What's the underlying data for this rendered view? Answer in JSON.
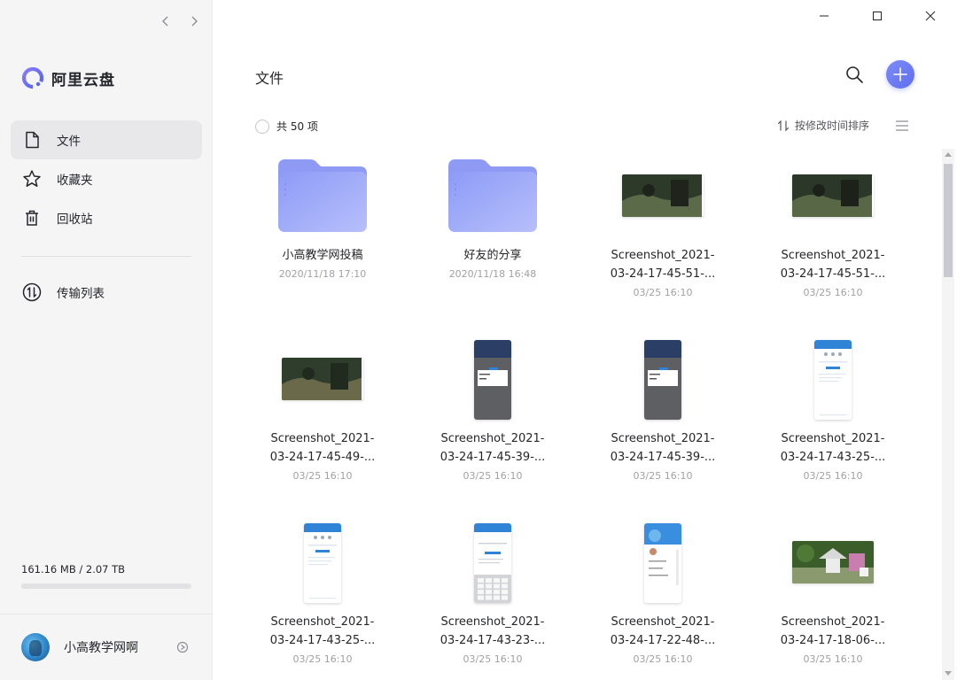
{
  "app": {
    "name": "阿里云盘",
    "accent": "#6372f2"
  },
  "sidebar": {
    "items": [
      {
        "label": "文件",
        "icon": "file-icon",
        "active": true
      },
      {
        "label": "收藏夹",
        "icon": "star-icon",
        "active": false
      },
      {
        "label": "回收站",
        "icon": "trash-icon",
        "active": false
      }
    ],
    "transfer": {
      "label": "传输列表",
      "icon": "transfer-icon"
    },
    "storage": {
      "text": "161.16 MB / 2.07 TB",
      "used_fraction": 0.0001
    },
    "user": {
      "name": "小高教学网啊"
    }
  },
  "main": {
    "title": "文件",
    "count_label": "共 50 项",
    "sort_label": "按修改时间排序"
  },
  "files": [
    {
      "name": "小高教学网投稿",
      "date": "2020/11/18 17:10",
      "kind": "folder"
    },
    {
      "name": "好友的分享",
      "date": "2020/11/18 16:48",
      "kind": "folder"
    },
    {
      "name": "Screenshot_2021-03-24-17-45-51-...",
      "date": "03/25 16:10",
      "kind": "landscape",
      "colors": [
        "#2d3a2a",
        "#5b6a48",
        "#1e241c"
      ]
    },
    {
      "name": "Screenshot_2021-03-24-17-45-51-...",
      "date": "03/25 16:10",
      "kind": "landscape",
      "colors": [
        "#2b3728",
        "#586846",
        "#1c221a"
      ]
    },
    {
      "name": "Screenshot_2021-03-24-17-45-49-...",
      "date": "03/25 16:10",
      "kind": "landscape",
      "colors": [
        "#2f3d2c",
        "#6a6a4a",
        "#202a1e"
      ]
    },
    {
      "name": "Screenshot_2021-03-24-17-45-39-...",
      "date": "03/25 16:10",
      "kind": "portrait-dark",
      "colors": [
        "#2a3e66",
        "#5e5f63",
        "#ffffff"
      ]
    },
    {
      "name": "Screenshot_2021-03-24-17-45-39-...",
      "date": "03/25 16:10",
      "kind": "portrait-dark",
      "colors": [
        "#2a3e66",
        "#5e5f63",
        "#ffffff"
      ]
    },
    {
      "name": "Screenshot_2021-03-24-17-43-25-...",
      "date": "03/25 16:10",
      "kind": "portrait-light",
      "colors": [
        "#2f84d8",
        "#ffffff",
        "#dfe7f3"
      ]
    },
    {
      "name": "Screenshot_2021-03-24-17-43-25-...",
      "date": "03/25 16:10",
      "kind": "portrait-light",
      "colors": [
        "#2f84d8",
        "#ffffff",
        "#dfe7f3"
      ]
    },
    {
      "name": "Screenshot_2021-03-24-17-43-23-...",
      "date": "03/25 16:10",
      "kind": "portrait-keyboard",
      "colors": [
        "#2f84d8",
        "#ffffff",
        "#d2d4d8"
      ]
    },
    {
      "name": "Screenshot_2021-03-24-17-22-48-...",
      "date": "03/25 16:10",
      "kind": "portrait-profile",
      "colors": [
        "#3a8ee0",
        "#ffffff",
        "#e9eaee"
      ]
    },
    {
      "name": "Screenshot_2021-03-24-17-18-06-...",
      "date": "03/25 16:10",
      "kind": "landscape-garden",
      "colors": [
        "#3b5d2a",
        "#8a9a6e",
        "#c87fb0"
      ]
    }
  ]
}
